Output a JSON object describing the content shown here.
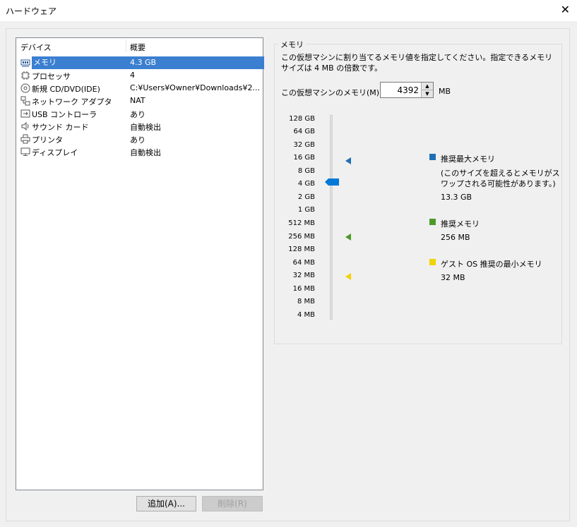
{
  "window": {
    "title": "ハードウェア",
    "close_glyph": "✕"
  },
  "device_list": {
    "columns": [
      "デバイス",
      "概要"
    ],
    "rows": [
      {
        "icon": "memory-icon",
        "name": "メモリ",
        "summary": "4.3 GB",
        "selected": true
      },
      {
        "icon": "processor-icon",
        "name": "プロセッサ",
        "summary": "4"
      },
      {
        "icon": "cd-dvd-icon",
        "name": "新規 CD/DVD(IDE)",
        "summary": "C:¥Users¥Owner¥Downloads¥2..."
      },
      {
        "icon": "network-adapter-icon",
        "name": "ネットワーク アダプタ",
        "summary": "NAT"
      },
      {
        "icon": "usb-icon",
        "name": "USB コントローラ",
        "summary": "あり"
      },
      {
        "icon": "sound-card-icon",
        "name": "サウンド カード",
        "summary": "自動検出"
      },
      {
        "icon": "printer-icon",
        "name": "プリンタ",
        "summary": "あり"
      },
      {
        "icon": "display-icon",
        "name": "ディスプレイ",
        "summary": "自動検出"
      }
    ]
  },
  "buttons": {
    "add": "追加(A)...",
    "remove": "削除(R)"
  },
  "memory": {
    "group_title": "メモリ",
    "description": "この仮想マシンに割り当てるメモリ値を指定してください。指定できるメモリ サイズは 4 MB の倍数です。",
    "field_label": "この仮想マシンのメモリ(M):",
    "value": "4392",
    "unit": "MB",
    "scale": [
      "128 GB",
      "64 GB",
      "32 GB",
      "16 GB",
      "8 GB",
      "4 GB",
      "2 GB",
      "1 GB",
      "512 MB",
      "256 MB",
      "128 MB",
      "64 MB",
      "32 MB",
      "16 MB",
      "8 MB",
      "4 MB"
    ],
    "legend": {
      "max": {
        "label": "推奨最大メモリ",
        "note": "(このサイズを超えるとメモリがスワップされる可能性があります。)",
        "value": "13.3 GB",
        "color": "#1f6fb5"
      },
      "recommended": {
        "label": "推奨メモリ",
        "value": "256 MB",
        "color": "#4c9a2a"
      },
      "guest_min": {
        "label": "ゲスト OS 推奨の最小メモリ",
        "value": "32 MB",
        "color": "#f2d200"
      }
    }
  }
}
